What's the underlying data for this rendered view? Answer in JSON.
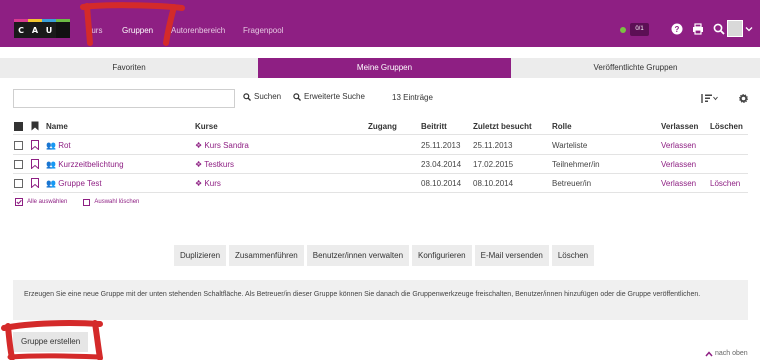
{
  "header": {
    "logo_letters": [
      "C",
      "A",
      "U"
    ],
    "nav": [
      {
        "label": "Kurs",
        "active": false
      },
      {
        "label": "Gruppen",
        "active": true
      },
      {
        "label": "Autorenbereich",
        "active": false
      },
      {
        "label": "Fragenpool",
        "active": false
      }
    ],
    "badge": "0/1",
    "icons": [
      "help-icon",
      "print-icon",
      "search-icon",
      "avatar",
      "chevron-down-icon"
    ]
  },
  "tabs": [
    {
      "label": "Favoriten",
      "active": false
    },
    {
      "label": "Meine Gruppen",
      "active": true
    },
    {
      "label": "Veröffentlichte Gruppen",
      "active": false
    }
  ],
  "search": {
    "value": "",
    "search_label": "Suchen",
    "advanced_label": "Erweiterte Suche",
    "count": "13 Einträge"
  },
  "table": {
    "headers": {
      "name": "Name",
      "kurse": "Kurse",
      "zugang": "Zugang",
      "beitritt": "Beitritt",
      "zuletzt": "Zuletzt besucht",
      "rolle": "Rolle",
      "verlassen": "Verlassen",
      "loeschen": "Löschen"
    },
    "rows": [
      {
        "name": "Rot",
        "kurs": "Kurs Sandra",
        "zugang": "",
        "beitritt": "25.11.2013",
        "zuletzt": "25.11.2013",
        "rolle": "Warteliste",
        "verlassen": "Verlassen",
        "loeschen": ""
      },
      {
        "name": "Kurzzeitbelichtung",
        "kurs": "Testkurs",
        "zugang": "",
        "beitritt": "23.04.2014",
        "zuletzt": "17.02.2015",
        "rolle": "Teilnehmer/in",
        "verlassen": "Verlassen",
        "loeschen": ""
      },
      {
        "name": "Gruppe Test",
        "kurs": "Kurs",
        "zugang": "",
        "beitritt": "08.10.2014",
        "zuletzt": "08.10.2014",
        "rolle": "Betreuer/in",
        "verlassen": "Verlassen",
        "loeschen": "Löschen"
      }
    ],
    "select_all": "Alle auswählen",
    "clear_selection": "Auswahl löschen"
  },
  "actions": [
    "Duplizieren",
    "Zusammenführen",
    "Benutzer/innen verwalten",
    "Konfigurieren",
    "E-Mail versenden",
    "Löschen"
  ],
  "info_text": "Erzeugen Sie eine neue Gruppe mit der unten stehenden Schaltfläche. Als Betreuer/in dieser Gruppe können Sie danach die Gruppenwerkzeuge freischalten, Benutzer/innen hinzufügen oder die Gruppe veröffentlichen.",
  "create_button": "Gruppe erstellen",
  "back_to_top": "nach oben",
  "colors": {
    "brand": "#8e1f83",
    "annotation": "#d42a2a",
    "status_dot": "#7bc043"
  }
}
